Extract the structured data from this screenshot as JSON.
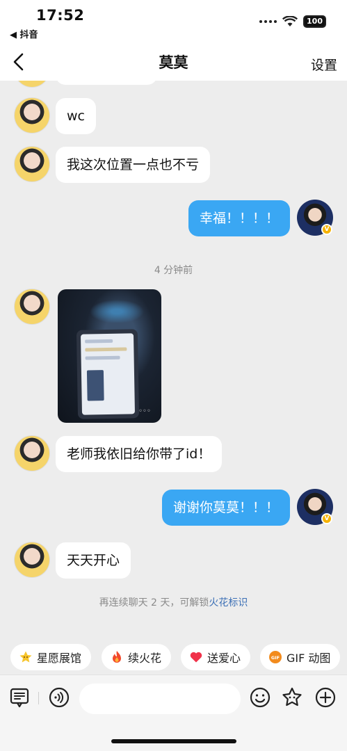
{
  "status_bar": {
    "time": "17:52",
    "back_app": "◀ 抖音",
    "battery": "100"
  },
  "nav": {
    "title": "莫莫",
    "settings": "设置"
  },
  "messages": [
    {
      "side": "in",
      "text": "wc"
    },
    {
      "side": "in",
      "text": "我这次位置一点也不亏"
    },
    {
      "side": "out",
      "text": "幸福！！！！"
    },
    {
      "side": "timestamp",
      "text": "4 分钟前"
    },
    {
      "side": "in",
      "type": "image"
    },
    {
      "side": "in",
      "text": "老师我依旧给你带了id！"
    },
    {
      "side": "out",
      "text": "谢谢你莫莫！！！"
    },
    {
      "side": "in",
      "text": "天天开心"
    }
  ],
  "spark_tip": {
    "prefix": "再连续聊天 2 天，可解锁",
    "link": "火花标识"
  },
  "chips": [
    {
      "label": "星愿展馆",
      "icon": "star-icon"
    },
    {
      "label": "续火花",
      "icon": "flame-icon"
    },
    {
      "label": "送爱心",
      "icon": "heart-icon"
    },
    {
      "label": "GIF 动图",
      "icon": "gif-icon"
    }
  ],
  "input": {
    "placeholder": ""
  },
  "colors": {
    "accent": "#3aa7f3",
    "link": "#3b6fb5",
    "background": "#ededed"
  }
}
